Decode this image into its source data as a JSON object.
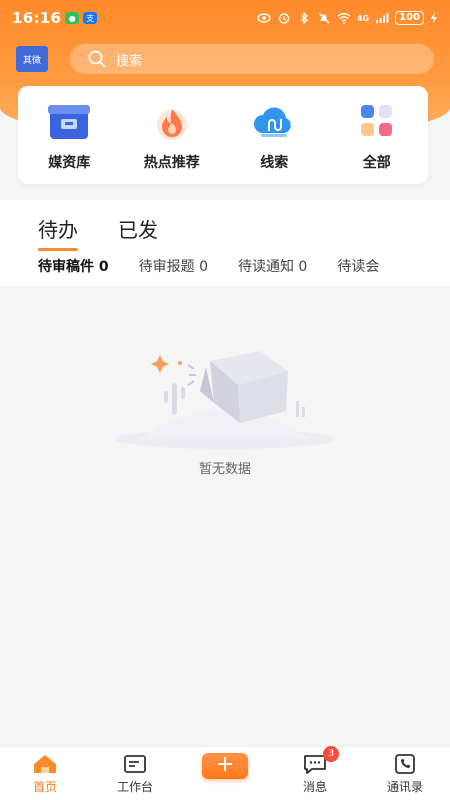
{
  "status_bar": {
    "time": "16:16",
    "battery": "100",
    "signal_text": "4G"
  },
  "header": {
    "org_badge": "其微",
    "search_placeholder": "搜索"
  },
  "quick_actions": [
    {
      "label": "媒资库",
      "icon": "media-library-icon"
    },
    {
      "label": "热点推荐",
      "icon": "hot-flame-icon"
    },
    {
      "label": "线索",
      "icon": "cloud-clue-icon"
    },
    {
      "label": "全部",
      "icon": "grid-all-icon"
    }
  ],
  "main_tabs": [
    {
      "label": "待办",
      "active": true
    },
    {
      "label": "已发",
      "active": false
    }
  ],
  "sub_tabs": [
    {
      "label": "待审稿件 0",
      "active": true
    },
    {
      "label": "待审报题 0",
      "active": false
    },
    {
      "label": "待读通知 0",
      "active": false
    },
    {
      "label": "待读会",
      "active": false
    }
  ],
  "empty_state": {
    "text": "暂无数据"
  },
  "bottom_nav": {
    "home": "首页",
    "workbench": "工作台",
    "add": "+",
    "messages": "消息",
    "messages_badge": "3",
    "contacts": "通讯录"
  },
  "colors": {
    "accent": "#ff8a2a",
    "badge": "#ff4a3a",
    "org_badge_bg": "#3f6ad8"
  }
}
